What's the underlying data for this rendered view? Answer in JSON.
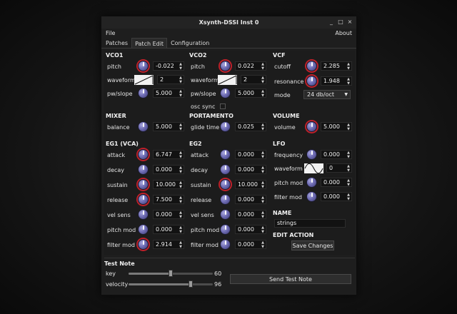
{
  "window": {
    "title": "Xsynth-DSSI Inst 0",
    "controls": [
      "_",
      "□",
      "×"
    ]
  },
  "menu": {
    "file": "File",
    "about": "About"
  },
  "tabs": [
    "Patches",
    "Patch Edit",
    "Configuration"
  ],
  "vco1": {
    "title": "VCO1",
    "pitch_label": "pitch",
    "pitch": "-0.022",
    "waveform_label": "waveform",
    "waveform": "2",
    "pw_label": "pw/slope",
    "pw": "5.000"
  },
  "vco2": {
    "title": "VCO2",
    "pitch_label": "pitch",
    "pitch": "0.022",
    "waveform_label": "waveform",
    "waveform": "2",
    "pw_label": "pw/slope",
    "pw": "5.000",
    "sync_label": "osc sync"
  },
  "vcf": {
    "title": "VCF",
    "cutoff_label": "cutoff",
    "cutoff": "2.285",
    "resonance_label": "resonance",
    "resonance": "1.948",
    "mode_label": "mode",
    "mode": "24 db/oct"
  },
  "mixer": {
    "title": "MIXER",
    "balance_label": "balance",
    "balance": "5.000"
  },
  "portamento": {
    "title": "PORTAMENTO",
    "glide_label": "glide time",
    "glide": "0.025"
  },
  "volume": {
    "title": "VOLUME",
    "volume_label": "volume",
    "volume": "5.000"
  },
  "eg1": {
    "title": "EG1 (VCA)",
    "rows": [
      {
        "label": "attack",
        "value": "6.747"
      },
      {
        "label": "decay",
        "value": "0.000"
      },
      {
        "label": "sustain",
        "value": "10.000"
      },
      {
        "label": "release",
        "value": "7.500"
      },
      {
        "label": "vel sens",
        "value": "0.000"
      },
      {
        "label": "pitch mod",
        "value": "0.000"
      },
      {
        "label": "filter mod",
        "value": "2.914"
      }
    ]
  },
  "eg2": {
    "title": "EG2",
    "rows": [
      {
        "label": "attack",
        "value": "0.000"
      },
      {
        "label": "decay",
        "value": "0.000"
      },
      {
        "label": "sustain",
        "value": "10.000"
      },
      {
        "label": "release",
        "value": "0.000"
      },
      {
        "label": "vel sens",
        "value": "0.000"
      },
      {
        "label": "pitch mod",
        "value": "0.000"
      },
      {
        "label": "filter mod",
        "value": "0.000"
      }
    ]
  },
  "lfo": {
    "title": "LFO",
    "frequency_label": "frequency",
    "frequency": "0.000",
    "waveform_label": "waveform",
    "waveform": "0",
    "pitchmod_label": "pitch mod",
    "pitchmod": "0.000",
    "filtermod_label": "filter mod",
    "filtermod": "0.000"
  },
  "name": {
    "title": "NAME",
    "value": "strings"
  },
  "edit_action": {
    "title": "EDIT ACTION",
    "save_label": "Save Changes"
  },
  "test_note": {
    "title": "Test Note",
    "key_label": "key",
    "key": "60",
    "velocity_label": "velocity",
    "velocity": "96",
    "send_label": "Send Test Note"
  },
  "colors": {
    "knob": "#6e6cb4",
    "knob_active_ring": "#c0202a",
    "background": "#1e1e1e"
  }
}
